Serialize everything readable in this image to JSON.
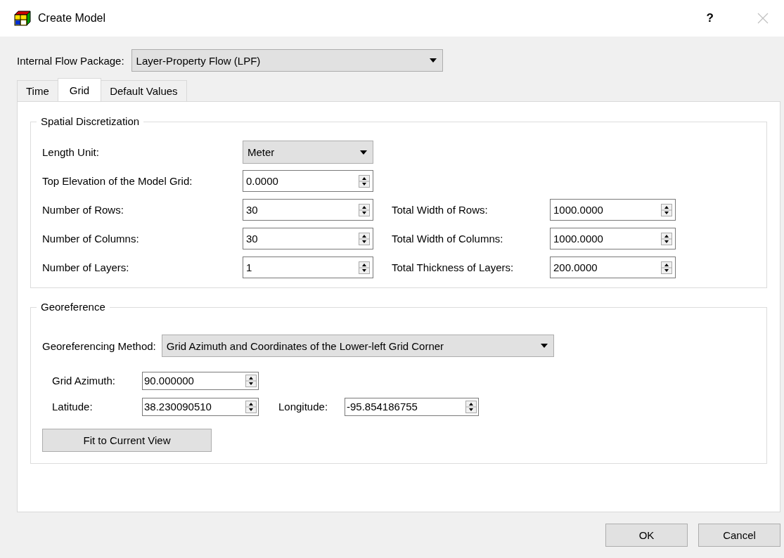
{
  "window": {
    "title": "Create Model",
    "help": "?"
  },
  "flow_package": {
    "label": "Internal Flow Package:",
    "value": "Layer-Property Flow (LPF)"
  },
  "tabs": [
    {
      "label": "Time",
      "selected": false
    },
    {
      "label": "Grid",
      "selected": true
    },
    {
      "label": "Default Values",
      "selected": false
    }
  ],
  "spatial": {
    "title": "Spatial Discretization",
    "left_fields": [
      {
        "kind": "combo",
        "label": "Length Unit:",
        "value": "Meter"
      },
      {
        "kind": "spin",
        "label": "Top Elevation of the Model Grid:",
        "value": "0.0000"
      },
      {
        "kind": "spin",
        "label": "Number of Rows:",
        "value": "30"
      },
      {
        "kind": "spin",
        "label": "Number of Columns:",
        "value": "30"
      },
      {
        "kind": "spin",
        "label": "Number of Layers:",
        "value": "1"
      }
    ],
    "right_fields": [
      {
        "kind": "spin",
        "label": "Total Width of Rows:",
        "value": "1000.0000"
      },
      {
        "kind": "spin",
        "label": "Total Width of Columns:",
        "value": "1000.0000"
      },
      {
        "kind": "spin",
        "label": "Total Thickness of Layers:",
        "value": "200.0000"
      }
    ]
  },
  "georeference": {
    "title": "Georeference",
    "method": {
      "label": "Georeferencing Method:",
      "value": "Grid Azimuth and Coordinates of the Lower-left Grid Corner"
    },
    "azimuth": {
      "label": "Grid Azimuth:",
      "value": "90.000000"
    },
    "latitude": {
      "label": "Latitude:",
      "value": "38.230090510"
    },
    "longitude": {
      "label": "Longitude:",
      "value": "-95.854186755"
    },
    "fit_button": "Fit to Current View"
  },
  "buttons": [
    "OK",
    "Cancel"
  ]
}
